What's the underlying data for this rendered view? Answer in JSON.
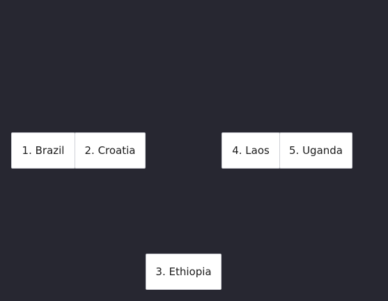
{
  "tiles": [
    {
      "label": "1. Brazil"
    },
    {
      "label": "2. Croatia"
    },
    {
      "label": "3. Ethiopia"
    },
    {
      "label": "4. Laos"
    },
    {
      "label": "5. Uganda"
    }
  ]
}
